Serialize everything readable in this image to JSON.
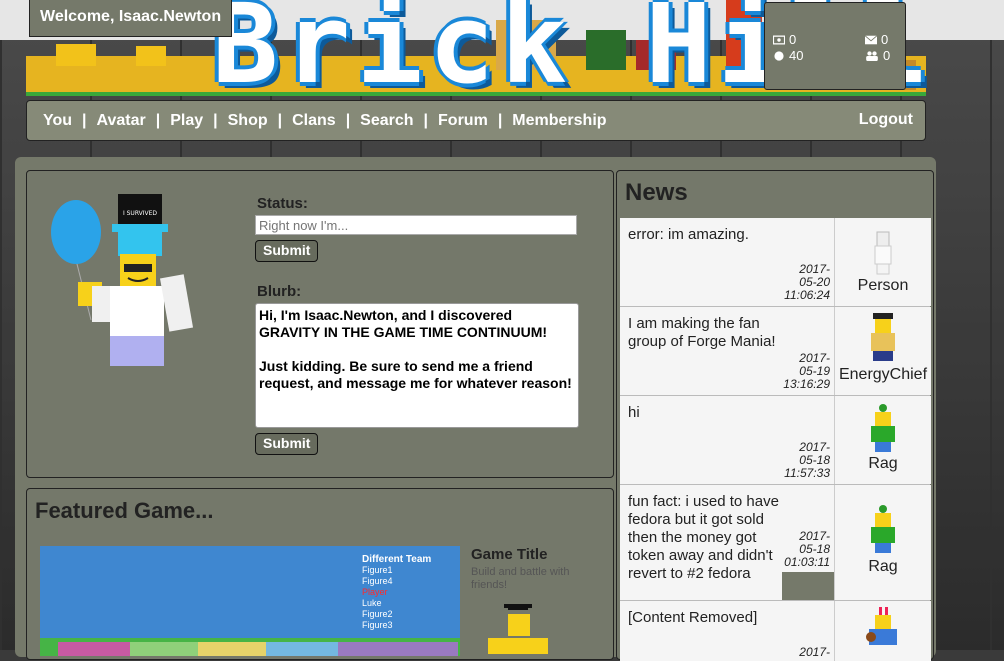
{
  "header": {
    "welcome_text": "Welcome, Isaac.Newton",
    "logo_text": "Brick Hill",
    "stats": {
      "bucks": "0",
      "messages": "0",
      "bits": "40",
      "friend_requests": "0"
    }
  },
  "nav": {
    "items": [
      "You",
      "Avatar",
      "Play",
      "Shop",
      "Clans",
      "Search",
      "Forum",
      "Membership"
    ],
    "separator": "|",
    "logout_label": "Logout"
  },
  "profile": {
    "status_label": "Status:",
    "status_placeholder": "Right now I'm...",
    "submit_label": "Submit",
    "blurb_label": "Blurb:",
    "blurb_text": "Hi, I'm Isaac.Newton, and I discovered GRAVITY IN THE GAME TIME CONTINUUM!\n\nJust kidding. Be sure to send me a friend request, and message me for whatever reason!",
    "hat_text": "I SURVIVED"
  },
  "featured": {
    "heading": "Featured Game...",
    "game_title": "Game Title",
    "game_description": "Build and battle with friends!",
    "thumb_team_header": "Different Team",
    "thumb_players": [
      "Figure1",
      "Figure4",
      "Player",
      "Luke",
      "Figure2",
      "Figure3"
    ]
  },
  "news": {
    "heading": "News",
    "items": [
      {
        "text": "error: im amazing.",
        "date": "2017-\n05-20\n11:06:24",
        "user": "Person"
      },
      {
        "text": "I am making the fan group of Forge Mania!",
        "date": "2017-\n05-19\n13:16:29",
        "user": "EnergyChief"
      },
      {
        "text": "hi",
        "date": "2017-\n05-18\n11:57:33",
        "user": "Rag"
      },
      {
        "text": "fun fact: i used to have fedora but it got sold then the money got token away and didn't revert to #2 fedora",
        "date": "2017-\n05-18\n01:03:11",
        "user": "Rag"
      },
      {
        "text": "[Content Removed]",
        "date": "2017-",
        "user": ""
      }
    ]
  },
  "colors": {
    "panel": "#75796a",
    "nav": "#868a78",
    "logo_blue": "#1a88d8",
    "news_bg": "#f5f5f5"
  }
}
